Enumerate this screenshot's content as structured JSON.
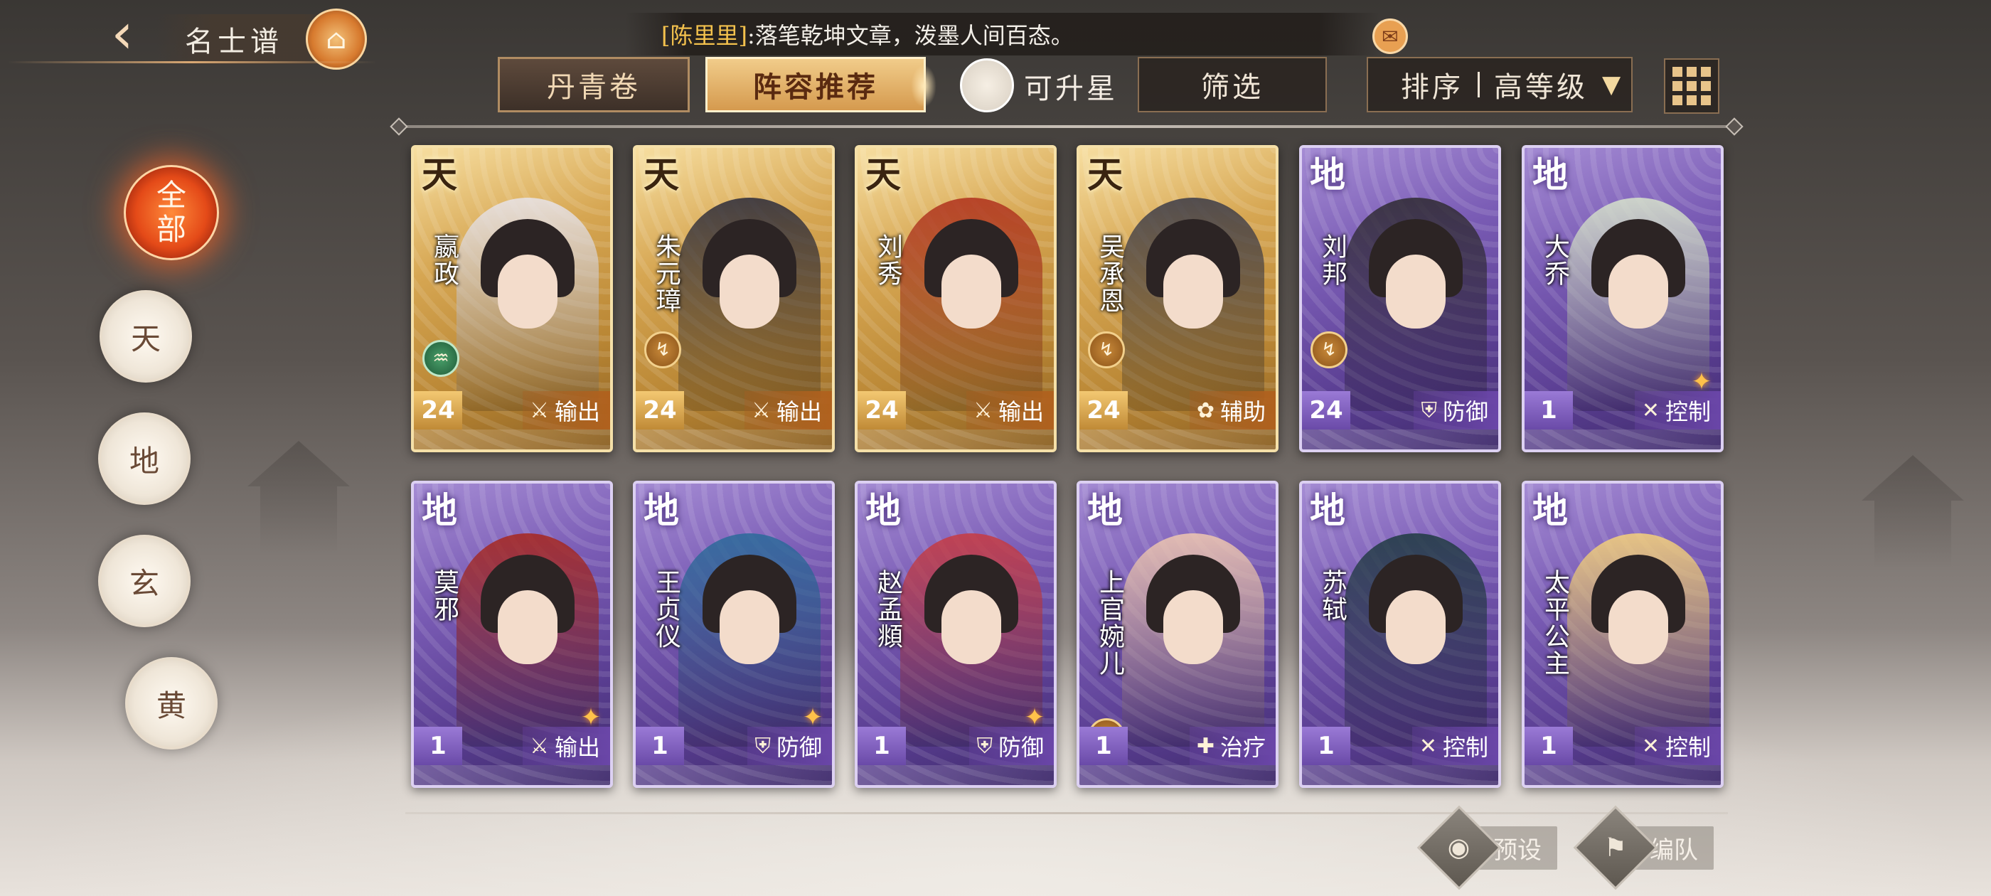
{
  "page": {
    "title": "名士谱",
    "title_seal_icon": "pavilion-icon"
  },
  "ticker": {
    "speaker": "[陈里里]",
    "message": ":落笔乾坤文章，泼墨人间百态。",
    "mail_icon": "mail-icon"
  },
  "toolbar": {
    "tab_scroll": "丹青卷",
    "tab_lineup": "阵容推荐",
    "can_upgrade": "可升星",
    "filter": "筛选",
    "sort_label": "排序",
    "sort_value": "高等级"
  },
  "side_filters": [
    {
      "label": "全部",
      "active": true
    },
    {
      "label": "天",
      "active": false
    },
    {
      "label": "地",
      "active": false
    },
    {
      "label": "玄",
      "active": false
    },
    {
      "label": "黄",
      "active": false
    }
  ],
  "side_all": {
    "line1": "全",
    "line2": "部"
  },
  "cards": [
    {
      "rank": "天",
      "name": "嬴政",
      "level": "24",
      "role": "输出",
      "tier": "gold",
      "element": "green"
    },
    {
      "rank": "天",
      "name": "朱元璋",
      "level": "24",
      "role": "输出",
      "tier": "gold",
      "element": "fire"
    },
    {
      "rank": "天",
      "name": "刘秀",
      "level": "24",
      "role": "输出",
      "tier": "gold",
      "element": "none"
    },
    {
      "rank": "天",
      "name": "吴承恩",
      "level": "24",
      "role": "辅助",
      "tier": "gold",
      "element": "fire"
    },
    {
      "rank": "地",
      "name": "刘邦",
      "level": "24",
      "role": "防御",
      "tier": "purple",
      "element": "fire"
    },
    {
      "rank": "地",
      "name": "大乔",
      "level": "1",
      "role": "控制",
      "tier": "purple",
      "element": "spark"
    },
    {
      "rank": "地",
      "name": "莫邪",
      "level": "1",
      "role": "输出",
      "tier": "purple",
      "element": "spark"
    },
    {
      "rank": "地",
      "name": "王贞仪",
      "level": "1",
      "role": "防御",
      "tier": "purple",
      "element": "spark"
    },
    {
      "rank": "地",
      "name": "赵孟頫",
      "level": "1",
      "role": "防御",
      "tier": "purple",
      "element": "spark"
    },
    {
      "rank": "地",
      "name": "上官婉儿",
      "level": "1",
      "role": "治疗",
      "tier": "purple",
      "element": "fire"
    },
    {
      "rank": "地",
      "name": "苏轼",
      "level": "1",
      "role": "控制",
      "tier": "purple",
      "element": "none"
    },
    {
      "rank": "地",
      "name": "太平公主",
      "level": "1",
      "role": "控制",
      "tier": "purple",
      "element": "none"
    }
  ],
  "bottom": {
    "preset": "预设",
    "team": "编队"
  },
  "colors": {
    "gold_card": "#d6a652",
    "purple_card": "#7a5cb5",
    "active_filter": "#e44a18",
    "ticker_name": "#f3c14d"
  }
}
